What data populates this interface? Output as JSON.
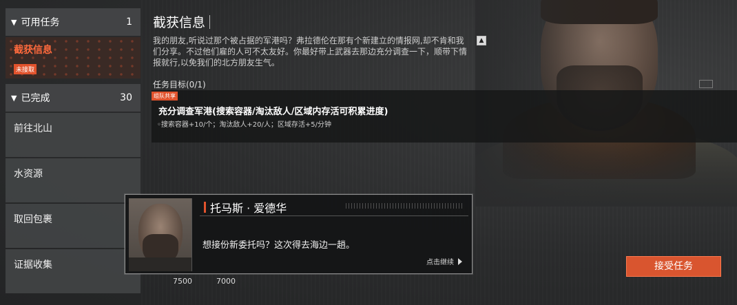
{
  "sidebar": {
    "available": {
      "label": "可用任务",
      "count": "1"
    },
    "active_task": {
      "label": "截获信息",
      "badge": "未接取"
    },
    "completed": {
      "label": "已完成",
      "count": "30"
    },
    "items": [
      {
        "label": "前往北山"
      },
      {
        "label": "水资源"
      },
      {
        "label": "取回包裹"
      },
      {
        "label": "证据收集"
      }
    ]
  },
  "task": {
    "title": "截获信息",
    "description": "我的朋友,听说过那个被占据的军港吗？弗拉德伦在那有个新建立的情报网,却不肯和我们分享。不过他们雇的人可不太友好。你最好带上武器去那边充分调查一下，顺带下情报就行,以免我们的北方朋友生气。",
    "objective_header": "任务目标(0/1)",
    "team_tag": "组队共享",
    "objective_main": "充分调查军港(搜索容器/淘汰敌人/区域内存活可积累进度)",
    "objective_sub": "◦搜索容器+10/个；淘汰敌人+20/人；区域存活+5/分钟"
  },
  "dialog": {
    "speaker": "托马斯 · 爱德华",
    "text": "想接份新委托吗？这次得去海边一趟。",
    "continue_label": "点击继续"
  },
  "rewards": {
    "left": "7500",
    "right": "7000"
  },
  "accept_label": "接受任务",
  "colors": {
    "accent": "#e2532d",
    "active_text": "#ff6a3d"
  },
  "icons": {
    "collapse": "chevron-up-icon",
    "continue": "play-icon",
    "expand": "triangle-down-icon"
  }
}
